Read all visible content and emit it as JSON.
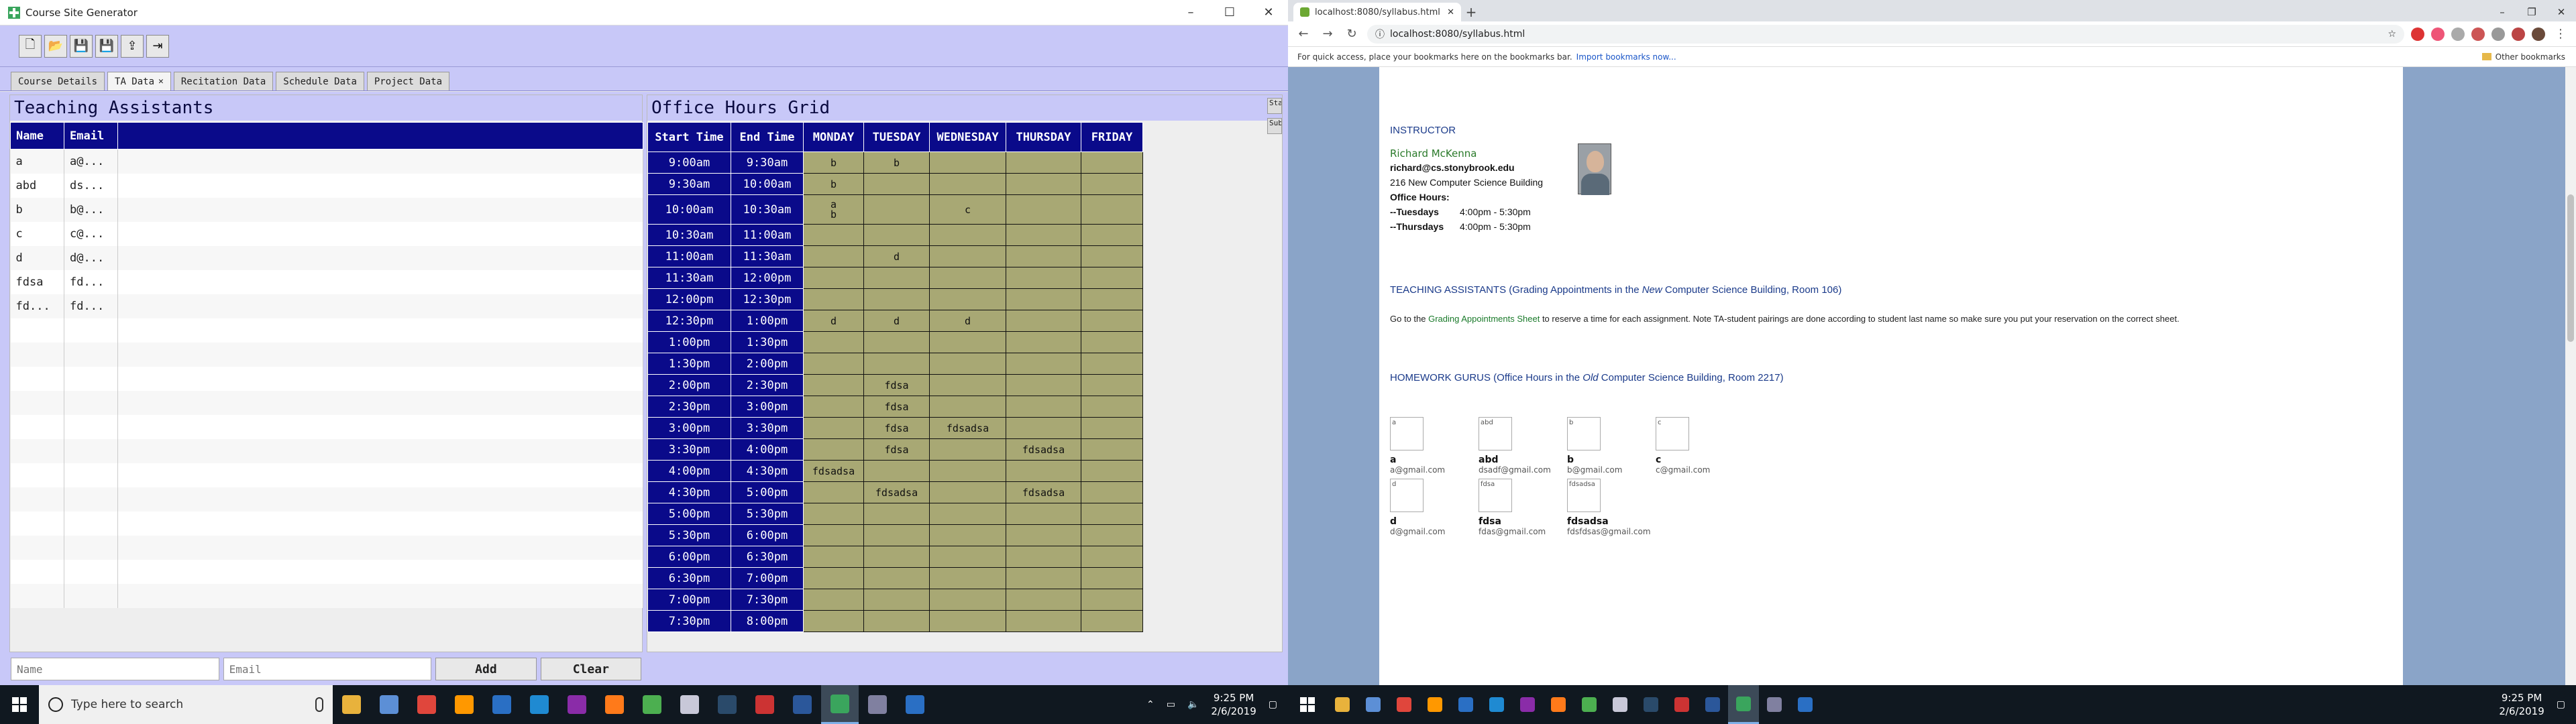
{
  "left": {
    "window_title": "Course Site Generator",
    "win_controls": [
      "–",
      "☐",
      "✕"
    ],
    "toolbar": [
      "new-icon",
      "open-icon",
      "save-icon",
      "save-as-icon",
      "export-icon",
      "exit-icon"
    ],
    "tabs": [
      {
        "label": "Course Details",
        "active": false
      },
      {
        "label": "TA Data",
        "active": true,
        "close": "✕"
      },
      {
        "label": "Recitation Data",
        "active": false
      },
      {
        "label": "Schedule Data",
        "active": false
      },
      {
        "label": "Project Data",
        "active": false
      }
    ],
    "ta_pane": {
      "title": "Teaching Assistants",
      "columns": [
        "Name",
        "Email"
      ],
      "rows": [
        [
          "a",
          "a@..."
        ],
        [
          "abd",
          "ds..."
        ],
        [
          "b",
          "b@..."
        ],
        [
          "c",
          "c@..."
        ],
        [
          "d",
          "d@..."
        ],
        [
          "fdsa",
          "fd..."
        ],
        [
          "fd...",
          "fd..."
        ]
      ],
      "name_placeholder": "Name",
      "email_placeholder": "Email",
      "add_label": "Add",
      "clear_label": "Clear"
    },
    "grid_pane": {
      "title": "Office Hours Grid",
      "side_tabs": [
        "Star",
        "Subm"
      ],
      "columns": [
        "Start Time",
        "End Time",
        "MONDAY",
        "TUESDAY",
        "WEDNESDAY",
        "THURSDAY",
        "FRIDAY"
      ],
      "rows": [
        [
          "9:00am",
          "9:30am",
          "b",
          "b",
          "",
          "",
          ""
        ],
        [
          "9:30am",
          "10:00am",
          "b",
          "",
          "",
          "",
          ""
        ],
        [
          "10:00am",
          "10:30am",
          "a\nb",
          "",
          "c",
          "",
          ""
        ],
        [
          "10:30am",
          "11:00am",
          "",
          "",
          "",
          "",
          ""
        ],
        [
          "11:00am",
          "11:30am",
          "",
          "d",
          "",
          "",
          ""
        ],
        [
          "11:30am",
          "12:00pm",
          "",
          "",
          "",
          "",
          ""
        ],
        [
          "12:00pm",
          "12:30pm",
          "",
          "",
          "",
          "",
          ""
        ],
        [
          "12:30pm",
          "1:00pm",
          "d",
          "d",
          "d",
          "",
          ""
        ],
        [
          "1:00pm",
          "1:30pm",
          "",
          "",
          "",
          "",
          ""
        ],
        [
          "1:30pm",
          "2:00pm",
          "",
          "",
          "",
          "",
          ""
        ],
        [
          "2:00pm",
          "2:30pm",
          "",
          "fdsa",
          "",
          "",
          ""
        ],
        [
          "2:30pm",
          "3:00pm",
          "",
          "fdsa",
          "",
          "",
          ""
        ],
        [
          "3:00pm",
          "3:30pm",
          "",
          "fdsa",
          "fdsadsa",
          "",
          ""
        ],
        [
          "3:30pm",
          "4:00pm",
          "",
          "fdsa",
          "",
          "fdsadsa",
          ""
        ],
        [
          "4:00pm",
          "4:30pm",
          "fdsadsa",
          "",
          "",
          "",
          ""
        ],
        [
          "4:30pm",
          "5:00pm",
          "",
          "fdsadsa",
          "",
          "fdsadsa",
          ""
        ],
        [
          "5:00pm",
          "5:30pm",
          "",
          "",
          "",
          "",
          ""
        ],
        [
          "5:30pm",
          "6:00pm",
          "",
          "",
          "",
          "",
          ""
        ],
        [
          "6:00pm",
          "6:30pm",
          "",
          "",
          "",
          "",
          ""
        ],
        [
          "6:30pm",
          "7:00pm",
          "",
          "",
          "",
          "",
          ""
        ],
        [
          "7:00pm",
          "7:30pm",
          "",
          "",
          "",
          "",
          ""
        ],
        [
          "7:30pm",
          "8:00pm",
          "",
          "",
          "",
          "",
          ""
        ]
      ]
    },
    "taskbar": {
      "search_placeholder": "Type here to search",
      "apps": [
        {
          "name": "file-explorer-icon",
          "color": "#e8b23c"
        },
        {
          "name": "box-icon",
          "color": "#5c8fd6"
        },
        {
          "name": "chrome-icon",
          "color": "#e0463c"
        },
        {
          "name": "sublime-icon",
          "color": "#ff9800"
        },
        {
          "name": "powershell-icon",
          "color": "#2a6fc4"
        },
        {
          "name": "vscode-icon",
          "color": "#1f8ad2"
        },
        {
          "name": "onenote-icon",
          "color": "#8a2ca8"
        },
        {
          "name": "firefox-icon",
          "color": "#ff7a1a"
        },
        {
          "name": "git-icon",
          "color": "#4caf50"
        },
        {
          "name": "app-icon",
          "color": "#c8c8d8"
        },
        {
          "name": "terminal-icon",
          "color": "#2a4a6a"
        },
        {
          "name": "paint-icon",
          "color": "#cc3333"
        },
        {
          "name": "word-icon",
          "color": "#2b579a"
        },
        {
          "name": "course-site-icon",
          "color": "#3aa55d"
        },
        {
          "name": "eclipse-icon",
          "color": "#8080a0"
        },
        {
          "name": "settings-icon",
          "color": "#2a6fc4"
        }
      ],
      "time": "9:25 PM",
      "date": "2/6/2019"
    }
  },
  "right": {
    "tab_title": "localhost:8080/syllabus.html",
    "new_tab": "+",
    "url": "localhost:8080/syllabus.html",
    "bookmarks_text": "For quick access, place your bookmarks here on the bookmarks bar.",
    "bookmarks_link": "Import bookmarks now...",
    "other_bookmarks": "Other bookmarks",
    "instructor_heading": "INSTRUCTOR",
    "instructor": {
      "name": "Richard McKenna",
      "email": "richard@cs.stonybrook.edu",
      "office": "216 New Computer Science Building",
      "office_hours_label": "Office Hours:",
      "hours": [
        {
          "day": "--Tuesdays",
          "time": "4:00pm - 5:30pm"
        },
        {
          "day": "--Thursdays",
          "time": "4:00pm - 5:30pm"
        }
      ]
    },
    "ta_heading_a": "TEACHING ASSISTANTS (Grading Appointments in the ",
    "ta_heading_em": "New",
    "ta_heading_b": " Computer Science Building, Room 106)",
    "ta_para_a": "Go to the ",
    "ta_para_link": "Grading Appointments Sheet",
    "ta_para_b": " to reserve a time for each assignment. Note TA-student pairings are done according to student last name so make sure you put your reservation on the correct sheet.",
    "gurus_heading_a": "HOMEWORK GURUS (Office Hours in the ",
    "gurus_heading_em": "Old",
    "gurus_heading_b": " Computer Science Building, Room 2217)",
    "gurus": [
      {
        "alt": "a",
        "name": "a",
        "email": "a@gmail.com"
      },
      {
        "alt": "abd",
        "name": "abd",
        "email": "dsadf@gmail.com"
      },
      {
        "alt": "b",
        "name": "b",
        "email": "b@gmail.com"
      },
      {
        "alt": "c",
        "name": "c",
        "email": "c@gmail.com"
      },
      {
        "alt": "d",
        "name": "d",
        "email": "d@gmail.com"
      },
      {
        "alt": "fdsa",
        "name": "fdsa",
        "email": "fdas@gmail.com"
      },
      {
        "alt": "fdsadsa",
        "name": "fdsadsa",
        "email": "fdsfdsas@gmail.com"
      }
    ],
    "taskbar": {
      "time": "9:25 PM",
      "date": "2/6/2019"
    }
  }
}
